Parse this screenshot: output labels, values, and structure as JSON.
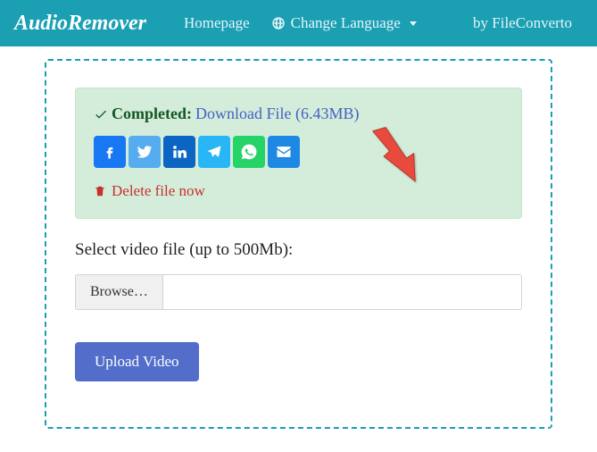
{
  "navbar": {
    "logo": "AudioRemover",
    "homepage": "Homepage",
    "changeLanguage": "Change Language",
    "byLink": "by FileConverto"
  },
  "alert": {
    "completed": "Completed:",
    "downloadLink": "Download File (6.43MB)",
    "deleteLink": "Delete file now"
  },
  "form": {
    "selectLabel": "Select video file (up to 500Mb):",
    "browseLabel": "Browse…",
    "uploadLabel": "Upload Video"
  }
}
